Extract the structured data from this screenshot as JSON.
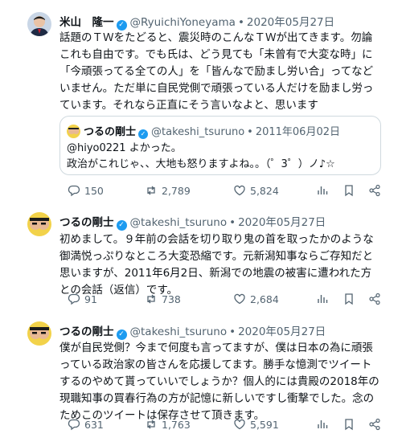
{
  "tweets": [
    {
      "name": "米山　隆一",
      "handle": "@RyuichiYoneyama",
      "date": "2020年05月27日",
      "text": "話題のＴＷをたどると、震災時のこんなＴＷが出てきます。勿論これも自由です。でも氏は、どう見ても「未曾有で大変な時」に「今頑張ってる全ての人」を「皆んなで励まし労い合」ってなどいません。ただ単に自民党側で頑張っている人だけを励まし労っています。それなら正直にそう言いなよと、思います",
      "quote": {
        "name": "つるの剛士",
        "handle": "@takeshi_tsuruno",
        "date": "2011年06月02日",
        "line1": "@hiyo0221 よかった。",
        "line2": "政治がこれじゃ、、大地も怒りますよね。。（゜3゜）ノ♪☆"
      },
      "replies": "150",
      "retweets": "2,789",
      "likes": "5,824"
    },
    {
      "name": "つるの剛士",
      "handle": "@takeshi_tsuruno",
      "date": "2020年05月27日",
      "text": "初めまして。９年前の会話を切り取り鬼の首を取ったかのような御満悦っぷりなところ大変恐縮です。元新潟知事ならご存知だと思いますが、2011年6月2日、新潟での地震の被害に遭われた方との会話（返信）です。",
      "replies": "91",
      "retweets": "738",
      "likes": "2,684"
    },
    {
      "name": "つるの剛士",
      "handle": "@takeshi_tsuruno",
      "date": "2020年05月27日",
      "text": "僕が自民党側？今まで何度も言ってますが、僕は日本の為に頑張っている政治家の皆さんを応援してます。勝手な憶測でツイートするのやめて貰っていいでしょうか？個人的には貴殿の2018年の現職知事の買春行為の方が記憶に新しいですし衝撃でした。念のためこのツイートは保存させて頂きます。",
      "replies": "631",
      "retweets": "1,763",
      "likes": "5,591"
    }
  ],
  "separator": "•",
  "verified_badge": "✓",
  "icons": [
    "reply-icon",
    "retweet-icon",
    "like-icon",
    "analytics-icon",
    "bookmark-icon",
    "share-icon"
  ],
  "colors": {
    "verified": "#1d9bf0",
    "meta": "#536471",
    "border": "#cfd9de"
  }
}
